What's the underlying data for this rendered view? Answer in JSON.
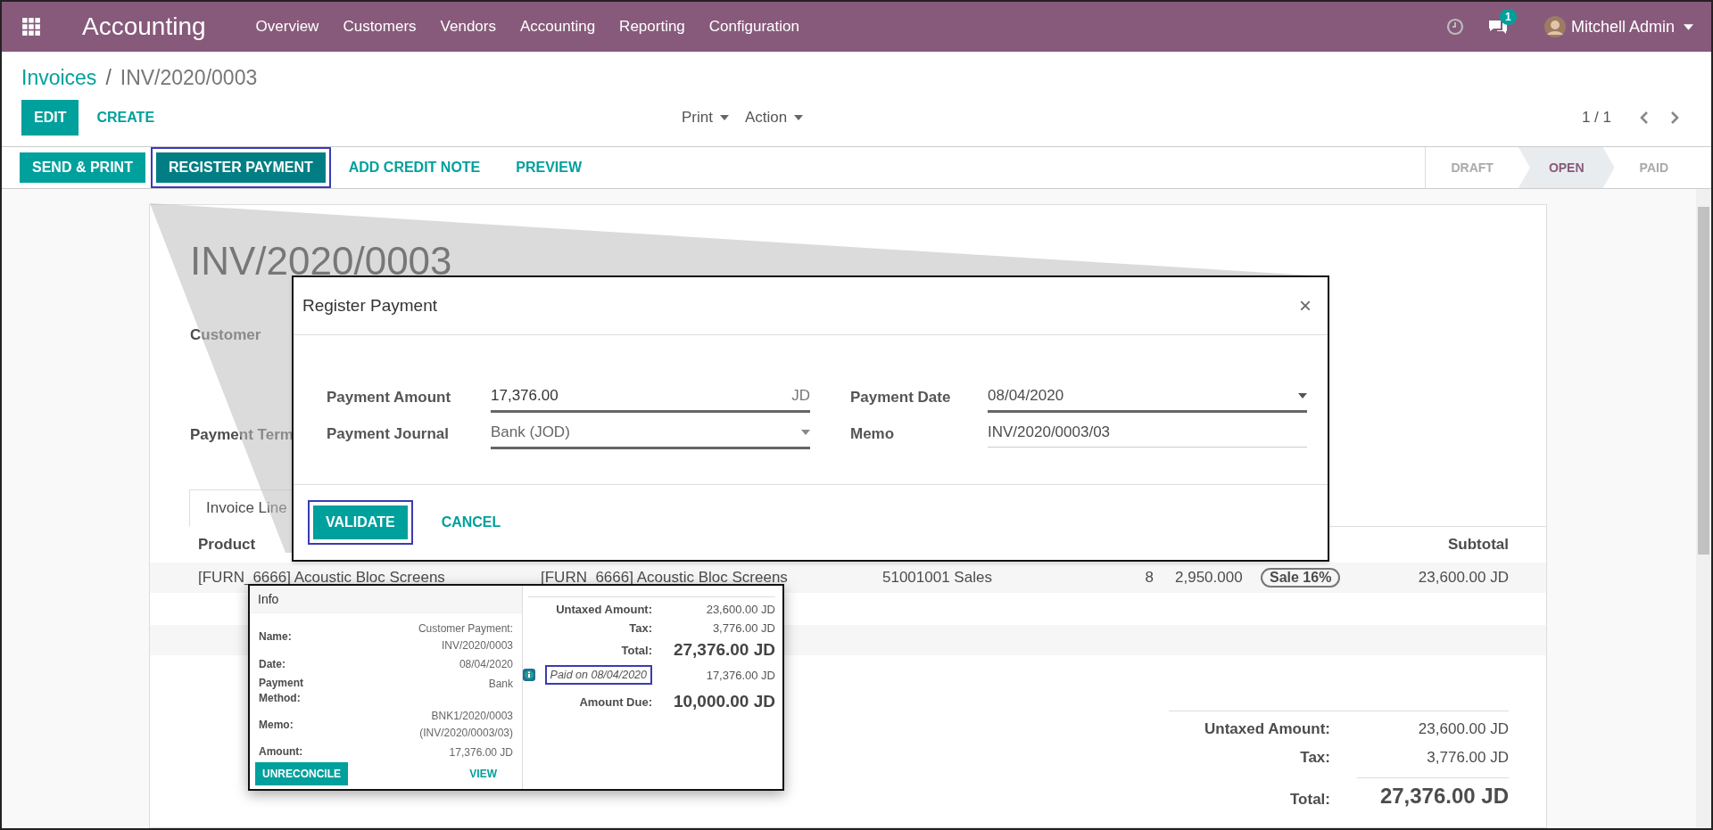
{
  "navbar": {
    "app_title": "Accounting",
    "menu": [
      "Overview",
      "Customers",
      "Vendors",
      "Accounting",
      "Reporting",
      "Configuration"
    ],
    "chat_badge": "1",
    "user": "Mitchell Admin"
  },
  "breadcrumb": {
    "parent": "Invoices",
    "separator": "/",
    "current": "INV/2020/0003"
  },
  "control_buttons": [
    {
      "label": "EDIT",
      "kind": "primary"
    },
    {
      "label": "CREATE",
      "kind": "link"
    }
  ],
  "dropdowns": [
    "Print",
    "Action"
  ],
  "pager": "1 / 1",
  "action_buttons": [
    {
      "label": "SEND & PRINT",
      "kind": "primary",
      "highlighted": false
    },
    {
      "label": "REGISTER PAYMENT",
      "kind": "dark",
      "highlighted": true
    },
    {
      "label": "ADD CREDIT NOTE",
      "kind": "link",
      "highlighted": false
    },
    {
      "label": "PREVIEW",
      "kind": "link",
      "highlighted": false
    }
  ],
  "status_steps": [
    {
      "label": "DRAFT",
      "selected": false
    },
    {
      "label": "OPEN",
      "selected": true
    },
    {
      "label": "PAID",
      "selected": false
    }
  ],
  "sheet": {
    "title": "INV/2020/0003",
    "customer_label": "Customer",
    "payment_terms_label": "Payment Term",
    "tab": "Invoice Line",
    "columns": [
      "Product",
      "Subtotal"
    ],
    "row": {
      "product": "[FURN_6666] Acoustic Bloc Screens",
      "label": "[FURN_6666] Acoustic Bloc Screens",
      "account": "51001001 Sales",
      "quantity": "8",
      "price": "2,950.000",
      "tax": "Sale 16%",
      "subtotal": "23,600.00 JD"
    },
    "totals": [
      {
        "label": "Untaxed Amount:",
        "value": "23,600.00 JD",
        "kind": "normal"
      },
      {
        "label": "Tax:",
        "value": "3,776.00 JD",
        "kind": "normal"
      },
      {
        "label": "Total:",
        "value": "27,376.00 JD",
        "kind": "grand"
      }
    ]
  },
  "modal": {
    "title": "Register Payment",
    "close": "×",
    "fields": [
      {
        "label": "Payment Amount",
        "value": "17,376.00",
        "suffix": "JD",
        "kind": "input"
      },
      {
        "label": "Payment Date",
        "value": "08/04/2020",
        "kind": "select"
      },
      {
        "label": "Payment Journal",
        "value": "Bank (JOD)",
        "kind": "select"
      },
      {
        "label": "Memo",
        "value": "INV/2020/0003/03",
        "kind": "plain"
      }
    ],
    "buttons": [
      {
        "label": "VALIDATE",
        "kind": "primary",
        "highlighted": true
      },
      {
        "label": "CANCEL",
        "kind": "link",
        "highlighted": false
      }
    ]
  },
  "popup": {
    "header": "Info",
    "rows": [
      {
        "label": [
          "Name:"
        ],
        "value": [
          "Customer Payment:",
          "INV/2020/0003"
        ]
      },
      {
        "label": [
          "Date:"
        ],
        "value": [
          "08/04/2020"
        ]
      },
      {
        "label": [
          "Payment",
          "Method:"
        ],
        "value": [
          "Bank"
        ]
      },
      {
        "label": [
          "Memo:"
        ],
        "value": [
          "BNK1/2020/0003",
          "(INV/2020/0003/03)"
        ]
      },
      {
        "label": [
          "Amount:"
        ],
        "value": [
          "17,376.00 JD"
        ]
      }
    ],
    "buttons": [
      {
        "label": "UNRECONCILE",
        "kind": "primary"
      },
      {
        "label": "VIEW",
        "kind": "link"
      }
    ],
    "totals": [
      {
        "label": "Untaxed Amount:",
        "value": "23,600.00 JD",
        "kind": "normal"
      },
      {
        "label": "Tax:",
        "value": "3,776.00 JD",
        "kind": "normal"
      },
      {
        "label": "Total:",
        "value": "27,376.00 JD",
        "kind": "grand"
      }
    ],
    "payment": {
      "label": "Paid on 08/04/2020",
      "value": "17,376.00 JD",
      "highlighted": true
    },
    "due": {
      "label": "Amount Due:",
      "value": "10,000.00 JD"
    }
  }
}
